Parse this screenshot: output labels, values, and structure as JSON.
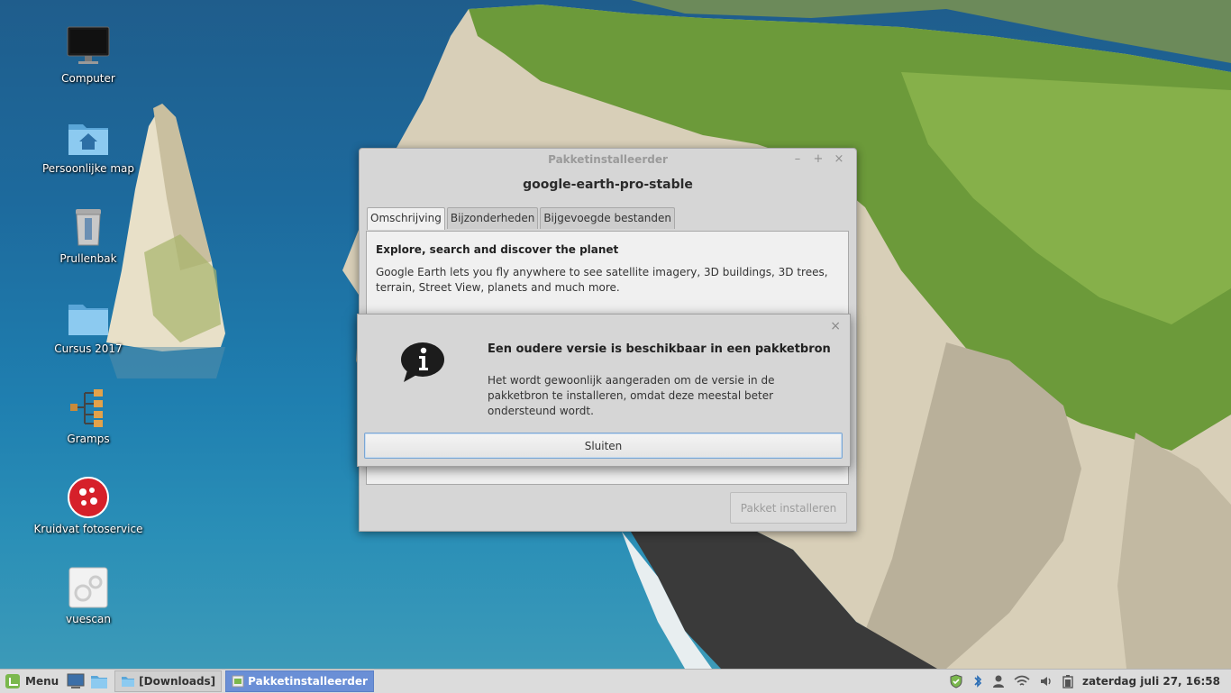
{
  "desktop": {
    "icons": [
      {
        "label": "Computer",
        "icon": "computer-icon"
      },
      {
        "label": "Persoonlijke map",
        "icon": "home-folder-icon"
      },
      {
        "label": "Prullenbak",
        "icon": "trash-icon"
      },
      {
        "label": "Cursus 2017",
        "icon": "folder-icon"
      },
      {
        "label": "Gramps",
        "icon": "gramps-icon"
      },
      {
        "label": "Kruidvat fotoservice",
        "icon": "kruidvat-icon"
      },
      {
        "label": "vuescan",
        "icon": "vuescan-icon"
      }
    ]
  },
  "window": {
    "title": "Pakketinstalleerder",
    "package_name": "google-earth-pro-stable",
    "tabs": [
      "Omschrijving",
      "Bijzonderheden",
      "Bijgevoegde bestanden"
    ],
    "active_tab": "Omschrijving",
    "description_heading": "Explore, search and discover the planet",
    "description_text": "Google Earth lets you fly anywhere to see satellite imagery, 3D buildings, 3D trees, terrain, Street View, planets and much more.",
    "install_button": "Pakket installeren",
    "controls": {
      "minimize": "–",
      "maximize": "+",
      "close": "×"
    }
  },
  "dialog": {
    "title": "Een oudere versie is beschikbaar in een pakketbron",
    "message": "Het wordt gewoonlijk aangeraden om de versie in de pakketbron te installeren, omdat deze meestal beter ondersteund wordt.",
    "close_button": "Sluiten",
    "close_glyph": "×",
    "icon": "info-icon"
  },
  "panel": {
    "menu_label": "Menu",
    "tasks": [
      {
        "label": "[Downloads]",
        "active": false
      },
      {
        "label": "Pakketinstalleerder",
        "active": true
      }
    ],
    "clock": "zaterdag juli 27, 16:58"
  },
  "colors": {
    "active_task": "#6a8fd6",
    "mint_green": "#7bb84d",
    "dialog_button_border": "#7aa6d4"
  }
}
